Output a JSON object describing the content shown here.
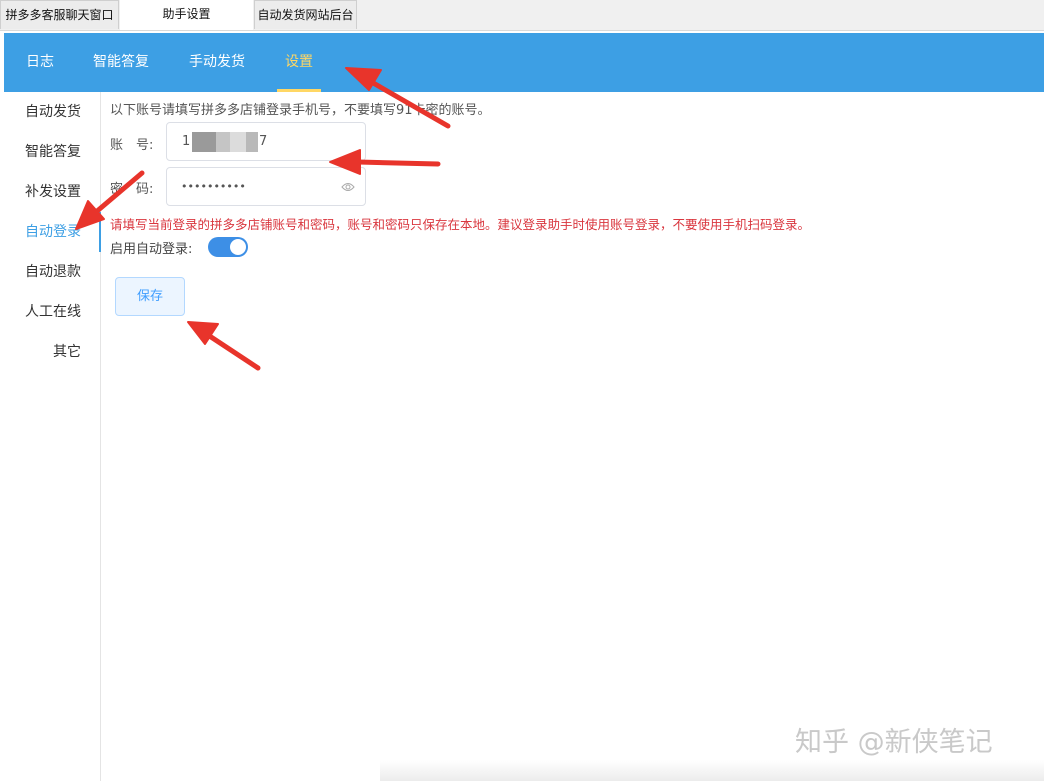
{
  "window_tabs": [
    {
      "label": "拼多多客服聊天窗口"
    },
    {
      "label": "助手设置"
    },
    {
      "label": "自动发货网站后台"
    }
  ],
  "nav": {
    "items": [
      {
        "label": "日志"
      },
      {
        "label": "智能答复"
      },
      {
        "label": "手动发货"
      },
      {
        "label": "设置"
      }
    ],
    "active": "设置"
  },
  "sidebar": {
    "items": [
      {
        "label": "自动发货"
      },
      {
        "label": "智能答复"
      },
      {
        "label": "补发设置"
      },
      {
        "label": "自动登录"
      },
      {
        "label": "自动退款"
      },
      {
        "label": "人工在线"
      },
      {
        "label": "其它"
      }
    ],
    "active": "自动登录"
  },
  "form": {
    "hint": "以下账号请填写拼多多店铺登录手机号，不要填写91卡密的账号。",
    "account_label": "账　号:",
    "account_value_start": "1",
    "account_value_end": "7",
    "password_label": "密　码:",
    "password_value": "••••••••••",
    "warning": "请填写当前登录的拼多多店铺账号和密码，账号和密码只保存在本地。建议登录助手时使用账号登录，不要使用手机扫码登录。",
    "auto_login_label": "启用自动登录:",
    "auto_login_enabled": true,
    "save_label": "保存"
  },
  "watermark": "知乎 @新侠笔记",
  "colors": {
    "nav_bg": "#3d9fe4",
    "nav_active": "#ffd764",
    "warning_text": "#d9363e",
    "annotation_arrow": "#e8342b"
  }
}
